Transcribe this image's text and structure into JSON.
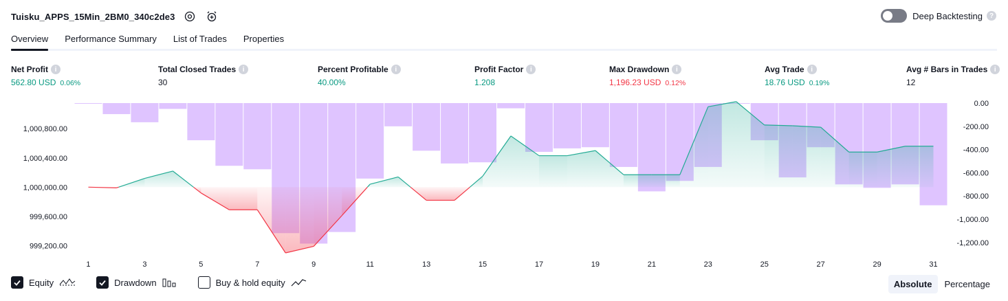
{
  "strategy": {
    "title": "Tuisku_APPS_15Min_2BM0_340c2de3"
  },
  "deep_backtesting": {
    "label": "Deep Backtesting",
    "help": "?"
  },
  "tabs": [
    {
      "label": "Overview"
    },
    {
      "label": "Performance Summary"
    },
    {
      "label": "List of Trades"
    },
    {
      "label": "Properties"
    }
  ],
  "metrics": [
    {
      "label": "Net Profit",
      "value": "562.80 USD",
      "pct": "0.06%",
      "tone": "pos",
      "info": "i"
    },
    {
      "label": "Total Closed Trades",
      "value": "30",
      "pct": "",
      "tone": "neu",
      "info": "i"
    },
    {
      "label": "Percent Profitable",
      "value": "40.00%",
      "pct": "",
      "tone": "pos",
      "info": "i"
    },
    {
      "label": "Profit Factor",
      "value": "1.208",
      "pct": "",
      "tone": "pos",
      "info": "i"
    },
    {
      "label": "Max Drawdown",
      "value": "1,196.23 USD",
      "pct": "0.12%",
      "tone": "neg",
      "info": "i"
    },
    {
      "label": "Avg Trade",
      "value": "18.76 USD",
      "pct": "0.19%",
      "tone": "pos",
      "info": "i"
    },
    {
      "label": "Avg # Bars in Trades",
      "value": "12",
      "pct": "",
      "tone": "neu",
      "info": "i"
    }
  ],
  "colors": {
    "positive": "#089981",
    "negative": "#f23645",
    "drawdown_bar": "#c99cff",
    "equity_line_pos": "#22ab94",
    "equity_line_neg": "#f23645"
  },
  "chart_data": {
    "type": "line",
    "x": [
      1,
      2,
      3,
      4,
      5,
      6,
      7,
      8,
      9,
      10,
      11,
      12,
      13,
      14,
      15,
      16,
      17,
      18,
      19,
      20,
      21,
      22,
      23,
      24,
      25,
      26,
      27,
      28,
      29,
      30,
      31
    ],
    "xticks": [
      "1",
      "3",
      "5",
      "7",
      "9",
      "11",
      "13",
      "15",
      "17",
      "19",
      "21",
      "23",
      "25",
      "27",
      "29",
      "31"
    ],
    "left_ticks": [
      "1,000,800.00",
      "1,000,400.00",
      "1,000,000.00",
      "999,600.00",
      "999,200.00"
    ],
    "right_ticks": [
      "0.00",
      "-200.00",
      "-400.00",
      "-600.00",
      "-800.00",
      "-1,000.00",
      "-1,200.00"
    ],
    "ylim_equity": [
      999100,
      1001150
    ],
    "ylim_drawdown": [
      -1290,
      0
    ],
    "series": [
      {
        "name": "Equity",
        "kind": "line",
        "values": [
          1000000,
          999990,
          1000120,
          1000220,
          999920,
          999690,
          999690,
          999100,
          999190,
          999610,
          1000040,
          1000140,
          999820,
          999820,
          1000150,
          1000700,
          1000430,
          1000430,
          1000500,
          1000170,
          1000170,
          1000170,
          1001100,
          1001170,
          1000850,
          1000840,
          1000820,
          1000480,
          1000480,
          1000560,
          1000560
        ]
      },
      {
        "name": "Drawdown",
        "kind": "bar",
        "values": [
          -5,
          -95,
          -165,
          -50,
          -320,
          -540,
          -570,
          -1120,
          -1210,
          -1110,
          -650,
          -200,
          -410,
          -520,
          -510,
          -45,
          -420,
          -390,
          -380,
          -550,
          -760,
          -670,
          -550,
          0,
          -320,
          -640,
          -380,
          -700,
          -730,
          -700,
          -880
        ]
      }
    ]
  },
  "legend": [
    {
      "label": "Equity",
      "checked": true
    },
    {
      "label": "Drawdown",
      "checked": true
    },
    {
      "label": "Buy & hold equity",
      "checked": false
    }
  ],
  "modes": [
    {
      "label": "Absolute",
      "active": true
    },
    {
      "label": "Percentage",
      "active": false
    }
  ]
}
